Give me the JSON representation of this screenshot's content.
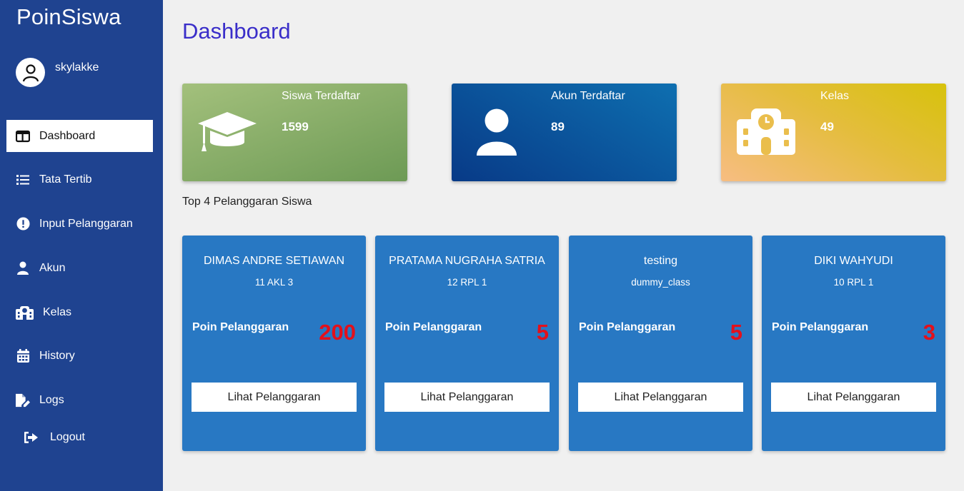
{
  "sidebar": {
    "brand": "PoinSiswa",
    "username": "skylakke",
    "items": [
      {
        "label": "Dashboard",
        "icon": "dashboard-icon"
      },
      {
        "label": "Tata Tertib",
        "icon": "list-icon"
      },
      {
        "label": "Input Pelanggaran",
        "icon": "exclamation-circle-icon"
      },
      {
        "label": "Akun",
        "icon": "user-icon"
      },
      {
        "label": "Kelas",
        "icon": "school-icon"
      },
      {
        "label": "History",
        "icon": "calendar-icon"
      },
      {
        "label": "Logs",
        "icon": "file-edit-icon"
      },
      {
        "label": "Logout",
        "icon": "logout-icon"
      }
    ]
  },
  "main": {
    "title": "Dashboard",
    "stats": [
      {
        "label": "Siswa Terdaftar",
        "value": "1599",
        "icon": "graduation-cap-icon"
      },
      {
        "label": "Akun Terdaftar",
        "value": "89",
        "icon": "user-icon"
      },
      {
        "label": "Kelas",
        "value": "49",
        "icon": "school-icon"
      }
    ],
    "section_label": "Top 4 Pelanggaran Siswa",
    "cards": [
      {
        "name": "DIMAS ANDRE SETIAWAN",
        "class": "11 AKL 3",
        "points_label": "Poin Pelanggaran",
        "points": "200",
        "button": "Lihat Pelanggaran"
      },
      {
        "name": "PRATAMA NUGRAHA SATRIA",
        "class": "12 RPL 1",
        "points_label": "Poin Pelanggaran",
        "points": "5",
        "button": "Lihat Pelanggaran"
      },
      {
        "name": "testing",
        "class": "dummy_class",
        "points_label": "Poin Pelanggaran",
        "points": "5",
        "button": "Lihat Pelanggaran"
      },
      {
        "name": "DIKI WAHYUDI",
        "class": "10 RPL 1",
        "points_label": "Poin Pelanggaran",
        "points": "3",
        "button": "Lihat Pelanggaran"
      }
    ]
  },
  "colors": {
    "sidebar": "#1f4390",
    "title": "#3a2ec9",
    "card": "#2878c3",
    "points": "#e3101b"
  }
}
